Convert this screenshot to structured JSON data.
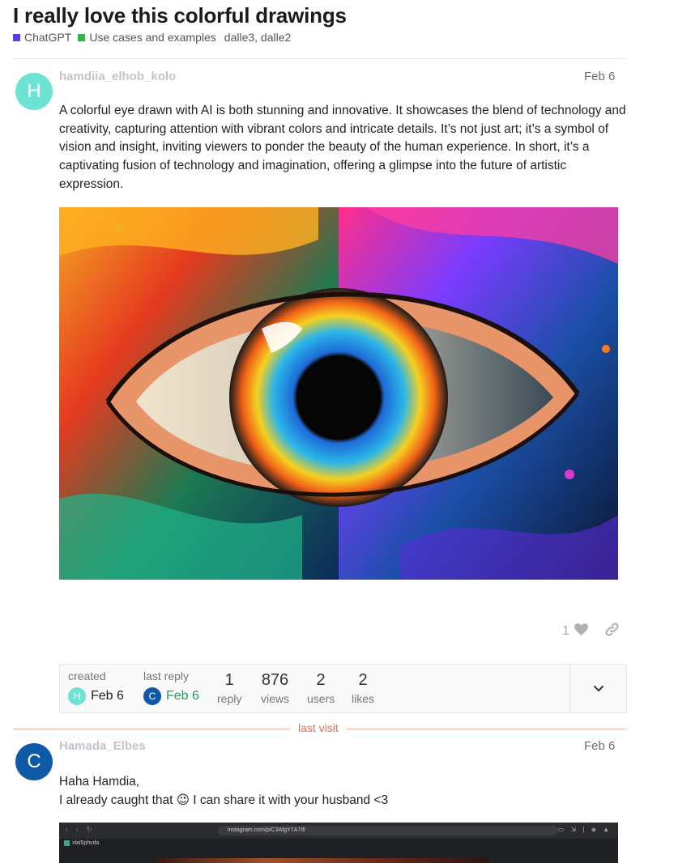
{
  "topic": {
    "title": "I really love this colorful drawings",
    "categories": [
      {
        "label": "ChatGPT",
        "color": "#5a3fe0"
      },
      {
        "label": "Use cases and examples",
        "color": "#38b14a"
      }
    ],
    "tags": "dalle3, dalle2"
  },
  "post1": {
    "avatar_letter": "H",
    "avatar_color": "#6fe3d3",
    "username": "hamdiia_elhob_kolo",
    "date": "Feb 6",
    "body": "A colorful eye drawn with AI is both stunning and innovative. It showcases the blend of technology and creativity, capturing attention with vibrant colors and intricate details. It’s not just art; it’s a symbol of vision and insight, inviting viewers to ponder the beauty of the human experience. In short, it’s a captivating fusion of technology and imagination, offering a glimpse into the future of artistic expression.",
    "image_icon": "colorful-eye-illustration",
    "like_count": "1",
    "like_icon": "heart-icon",
    "share_icon": "link-icon"
  },
  "topic_map": {
    "created_label": "created",
    "created_avatar_letter": "H",
    "created_date": "Feb 6",
    "last_reply_label": "last reply",
    "last_reply_avatar_letter": "C",
    "last_reply_date": "Feb 6",
    "stats": [
      {
        "num": "1",
        "unit": "reply"
      },
      {
        "num": "876",
        "unit": "views"
      },
      {
        "num": "2",
        "unit": "users"
      },
      {
        "num": "2",
        "unit": "likes"
      }
    ],
    "toggle_icon": "chevron-down-icon"
  },
  "last_visit_label": "last visit",
  "post2": {
    "avatar_letter": "C",
    "avatar_color": "#0e5aa7",
    "username": "Hamada_Elbes",
    "date": "Feb 6",
    "line1": "Haha Hamdia,",
    "line2_a": "I already caught that",
    "emoji": "😉",
    "line2_b": "I can share it with your husband <3",
    "screenshot_url": "instagram.com/p/C3AfgY7A7If/",
    "screenshot_tab": "xlal5phvda"
  }
}
